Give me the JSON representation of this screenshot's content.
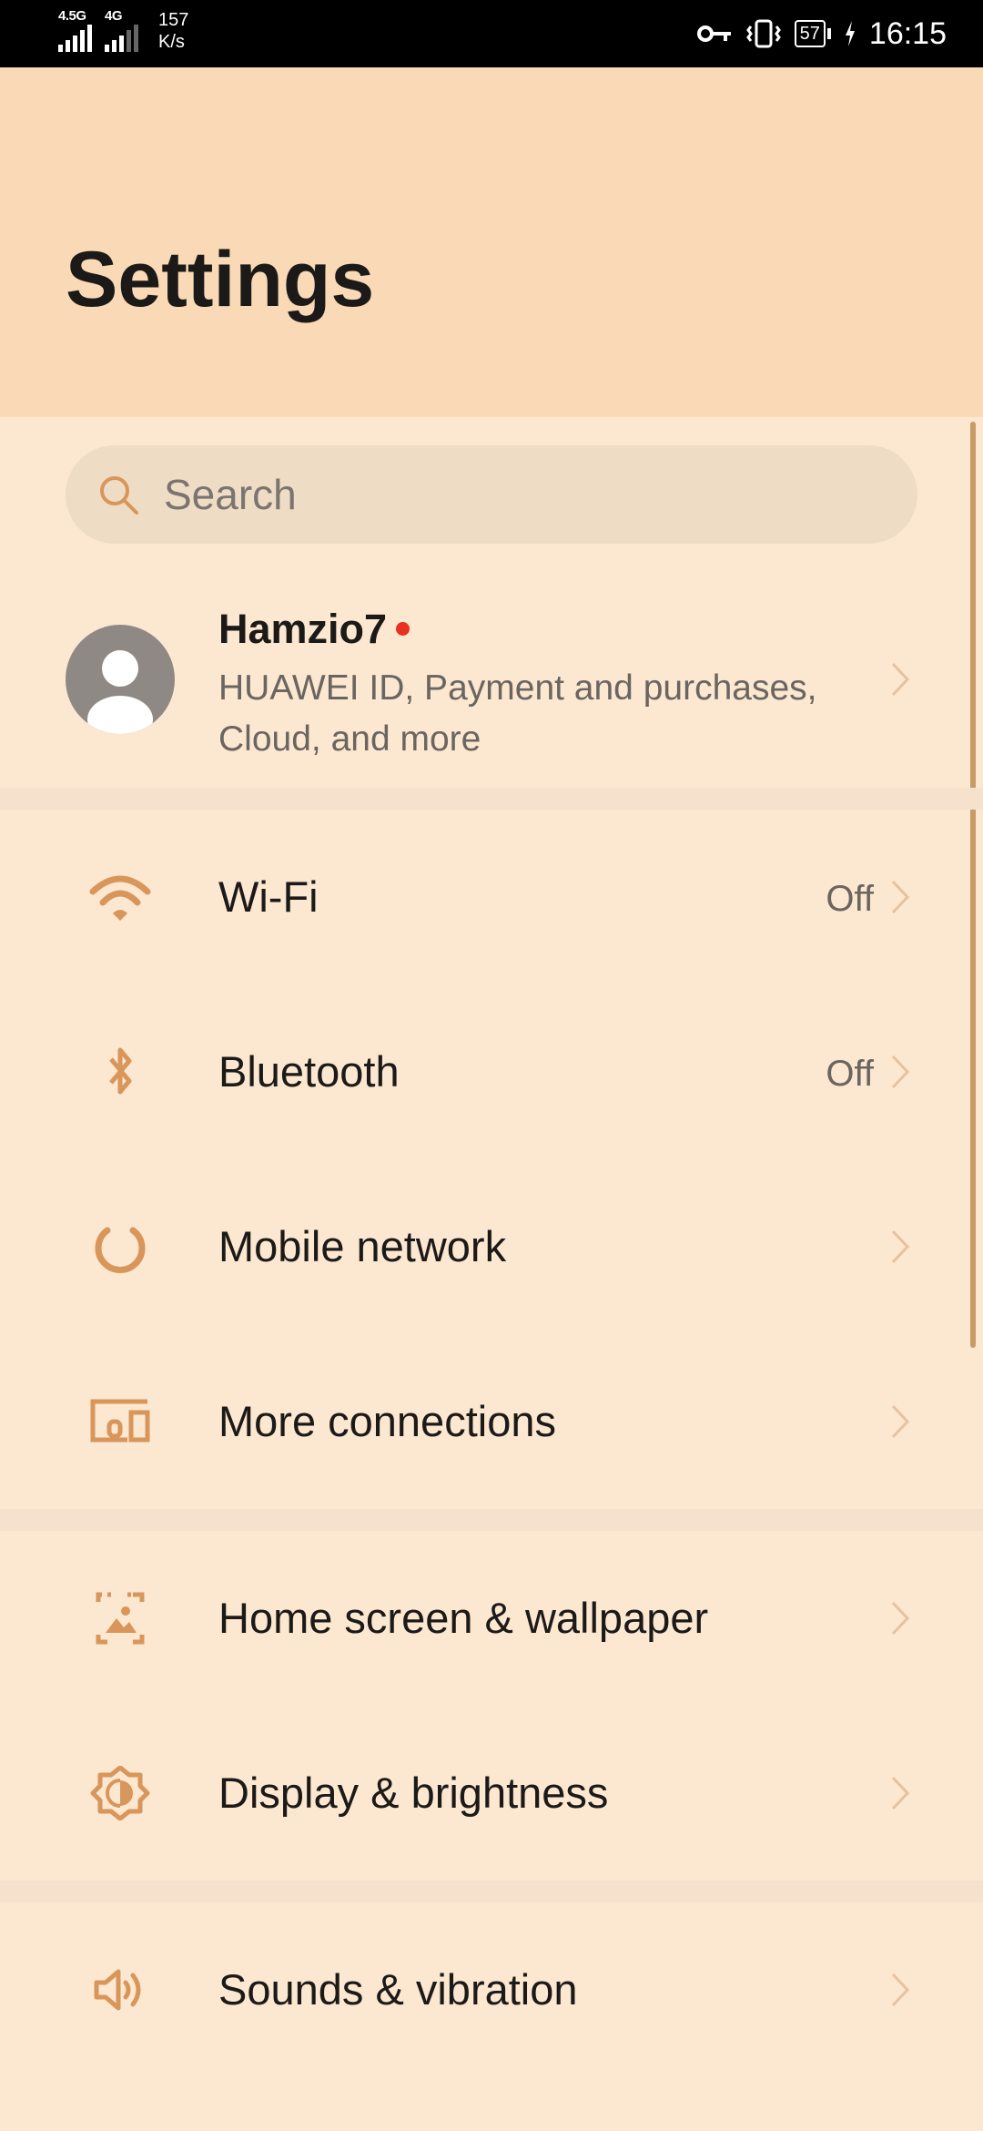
{
  "status_bar": {
    "sim1_label": "4.5G",
    "sim2_label": "4G",
    "speed_value": "157",
    "speed_unit": "K/s",
    "battery": "57",
    "time": "16:15"
  },
  "header": {
    "title": "Settings"
  },
  "search": {
    "placeholder": "Search"
  },
  "profile": {
    "name": "Hamzio7",
    "subtitle": "HUAWEI ID, Payment and purchases, Cloud, and more"
  },
  "rows": [
    {
      "label": "Wi-Fi",
      "value": "Off",
      "icon": "wifi-icon"
    },
    {
      "label": "Bluetooth",
      "value": "Off",
      "icon": "bluetooth-icon"
    },
    {
      "label": "Mobile network",
      "value": "",
      "icon": "mobile-network-icon"
    },
    {
      "label": "More connections",
      "value": "",
      "icon": "more-connections-icon"
    },
    {
      "label": "Home screen & wallpaper",
      "value": "",
      "icon": "wallpaper-icon"
    },
    {
      "label": "Display & brightness",
      "value": "",
      "icon": "brightness-icon"
    },
    {
      "label": "Sounds & vibration",
      "value": "",
      "icon": "speaker-icon"
    }
  ],
  "colors": {
    "header_bg": "#F9D9B6",
    "page_bg": "#FCE7D1",
    "accent": "#D9965A",
    "notification_dot": "#E8321F"
  }
}
